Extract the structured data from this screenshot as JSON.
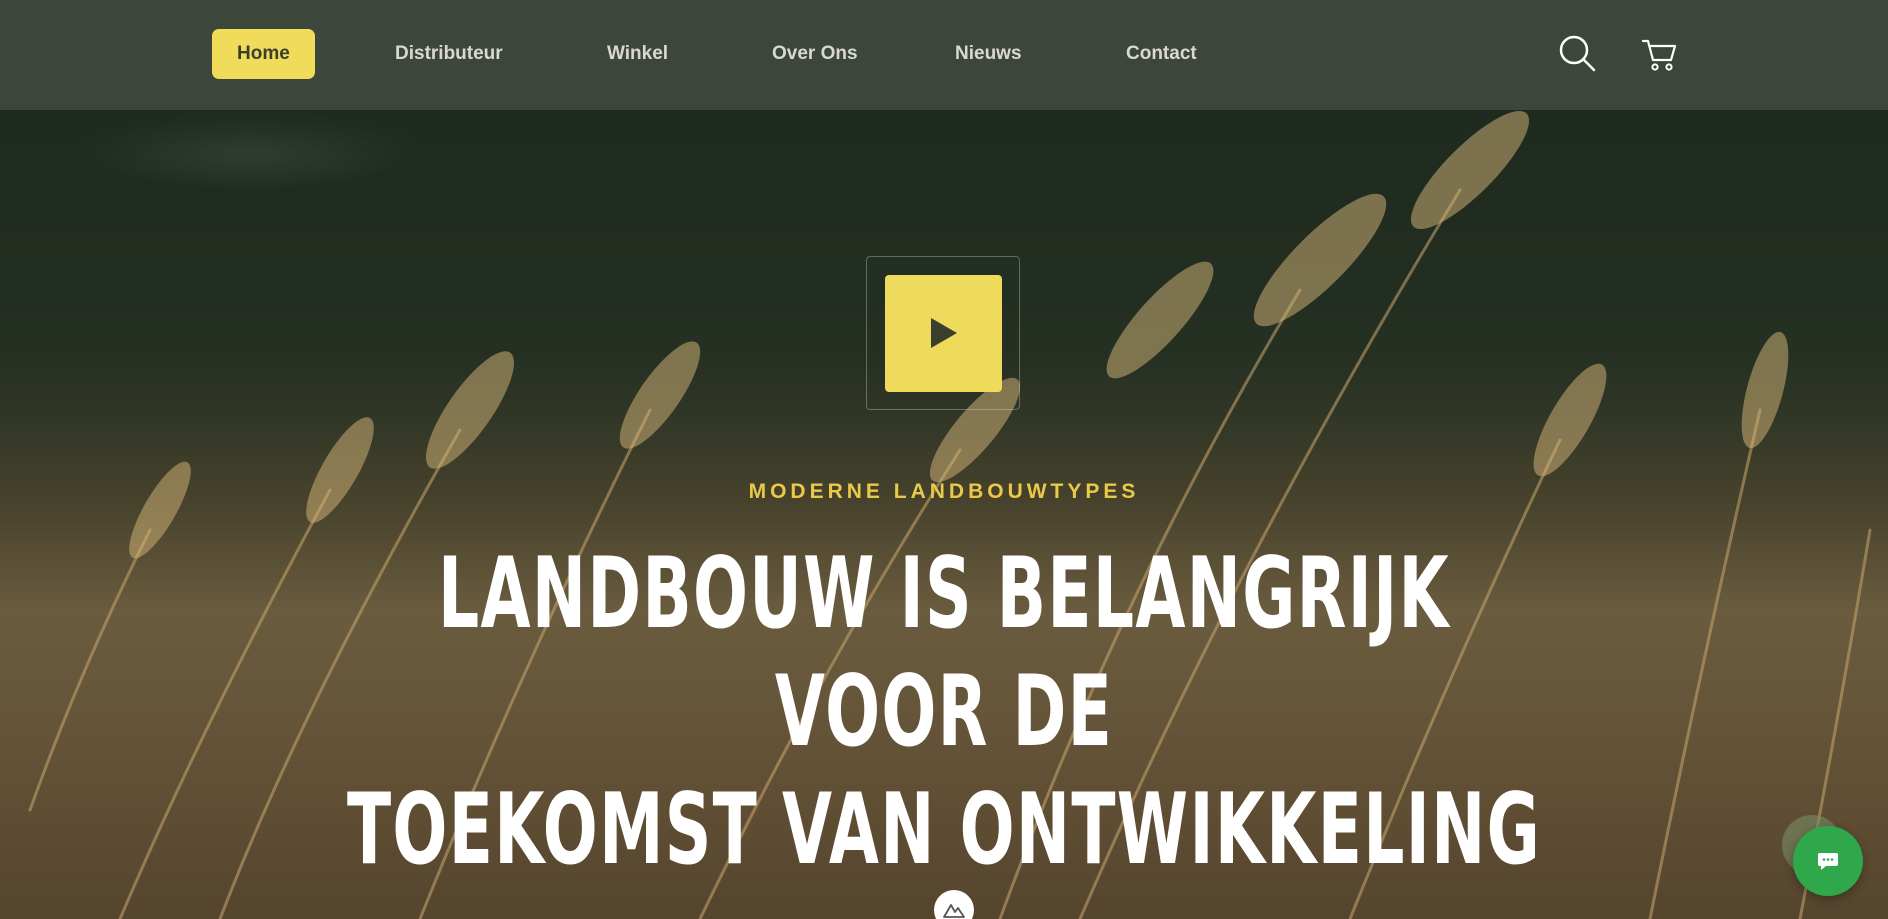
{
  "nav": {
    "items": [
      {
        "label": "Home",
        "active": true
      },
      {
        "label": "Distributeur",
        "active": false
      },
      {
        "label": "Winkel",
        "active": false
      },
      {
        "label": "Over Ons",
        "active": false
      },
      {
        "label": "Nieuws",
        "active": false
      },
      {
        "label": "Contact",
        "active": false
      }
    ],
    "icons": [
      "search-icon",
      "cart-icon"
    ]
  },
  "hero": {
    "eyebrow": "MODERNE LANDBOUWTYPES",
    "headline_line1": "LANDBOUW IS BELANGRIJK VOOR DE",
    "headline_line2": "TOEKOMST VAN ONTWIKKELING",
    "play_icon": "play-icon"
  },
  "widgets": {
    "chat_icon": "chat-icon",
    "scroll_icon": "logo-mountain-icon"
  },
  "colors": {
    "header_bg": "#3d463a",
    "accent_yellow": "#f0dc5a",
    "eyebrow_gold": "#e8c94a",
    "chat_green": "#2ea84a"
  }
}
